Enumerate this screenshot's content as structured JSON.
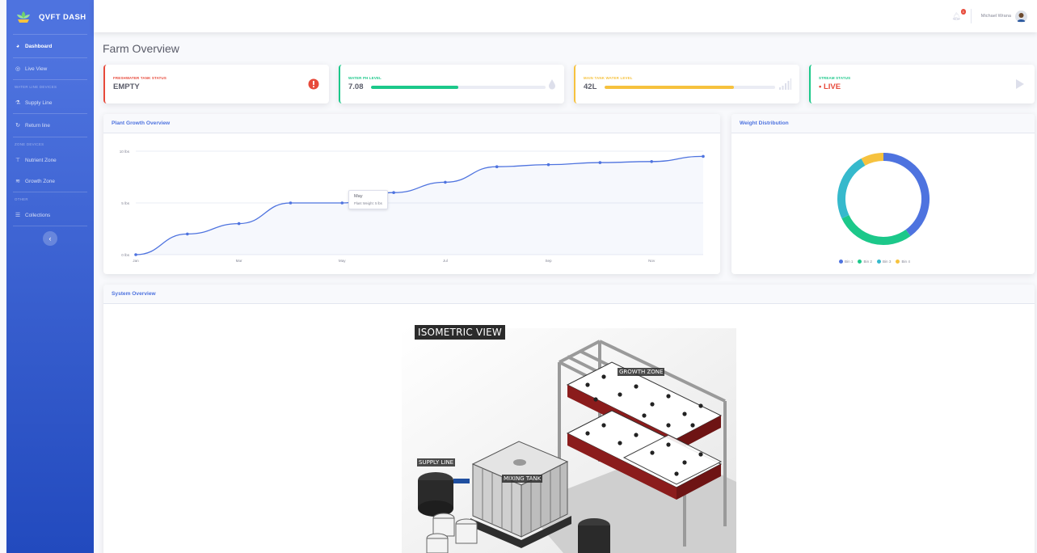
{
  "brand": {
    "name": "QVFT DASH"
  },
  "sidebar": {
    "items": [
      {
        "label": "Dashboard",
        "icon": "dashboard-icon",
        "active": true
      },
      {
        "label": "Live View",
        "icon": "live-icon"
      }
    ],
    "sections": [
      {
        "heading": "WATER LINE DEVICES",
        "items": [
          {
            "label": "Supply Line",
            "icon": "supply-icon"
          },
          {
            "label": "Return line",
            "icon": "return-icon"
          }
        ]
      },
      {
        "heading": "ZONE DEVICES",
        "items": [
          {
            "label": "Nutrient Zone",
            "icon": "nutrient-icon"
          },
          {
            "label": "Growth Zone",
            "icon": "growth-icon"
          }
        ]
      },
      {
        "heading": "OTHER",
        "items": [
          {
            "label": "Collections",
            "icon": "collections-icon"
          }
        ]
      }
    ]
  },
  "topbar": {
    "user_name": "Michael Wrana",
    "alert_count": "3"
  },
  "page": {
    "title": "Farm Overview"
  },
  "stats": [
    {
      "label": "FRESHWATER TANK STATUS",
      "value": "EMPTY",
      "color": "#e74a3b",
      "icon": "alert-circle-icon"
    },
    {
      "label": "WATER PH LEVEL",
      "value": "7.08",
      "color": "#1cc88a",
      "progress": 0.5,
      "icon": "water-drop-icon"
    },
    {
      "label": "MAIN TANK WATER LEVEL",
      "value": "42L",
      "color": "#f6c23e",
      "progress": 0.76,
      "icon": "signal-bars-icon"
    },
    {
      "label": "STREAM STATUS",
      "value": "• LIVE",
      "color": "#e74a3b",
      "border": "#1cc88a",
      "icon": "play-icon"
    }
  ],
  "growth_card": {
    "title": "Plant Growth Overview"
  },
  "weight_card": {
    "title": "Weight Distribution"
  },
  "system_card": {
    "title": "System Overview"
  },
  "tooltip": {
    "title": "May",
    "body": "Plant Weight: 5 lbs"
  },
  "render": {
    "title": "ISOMETRIC VIEW",
    "labels": [
      "GROWTH ZONE",
      "SUPPLY LINE",
      "MIXING TANK"
    ]
  },
  "colors": {
    "primary": "#4e73df",
    "success": "#1cc88a",
    "info": "#36b9cc",
    "warning": "#f6c23e",
    "danger": "#e74a3b"
  },
  "chart_data": [
    {
      "type": "area",
      "title": "Plant Growth Overview",
      "x": [
        "Jan",
        "Feb",
        "Mar",
        "Apr",
        "May",
        "Jun",
        "Jul",
        "Aug",
        "Sep",
        "Oct",
        "Nov",
        "Dec"
      ],
      "x_tick_labels": [
        "Jan",
        "Mar",
        "May",
        "Jul",
        "Sep",
        "Nov"
      ],
      "series": [
        {
          "values": [
            0,
            2,
            3,
            5,
            5,
            6,
            7,
            8.5,
            8.7,
            8.9,
            9,
            9.5
          ]
        }
      ],
      "y_tick_labels": [
        "10 lbs",
        "5 lbs",
        "0 lbs"
      ],
      "ylim": [
        0,
        10
      ],
      "grid": true,
      "color": "#4e73df"
    },
    {
      "type": "pie",
      "title": "Weight Distribution",
      "categories": [
        "Bin 1",
        "Bin 2",
        "Bin 3",
        "Bin 4"
      ],
      "values": [
        40,
        28,
        24,
        8
      ],
      "colors": [
        "#4e73df",
        "#1cc88a",
        "#36b9cc",
        "#f6c23e"
      ],
      "legend": "bottom"
    }
  ]
}
